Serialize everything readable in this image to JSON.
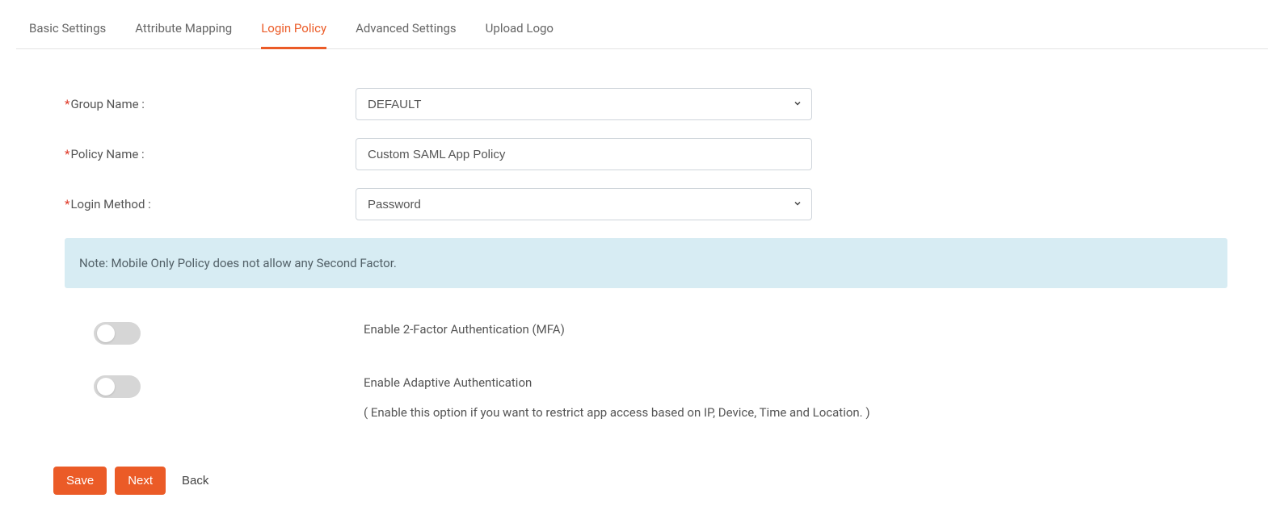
{
  "tabs": [
    {
      "label": "Basic Settings"
    },
    {
      "label": "Attribute Mapping"
    },
    {
      "label": "Login Policy"
    },
    {
      "label": "Advanced Settings"
    },
    {
      "label": "Upload Logo"
    }
  ],
  "form": {
    "group_name_label": "Group Name :",
    "group_name_value": "DEFAULT",
    "policy_name_label": "Policy Name :",
    "policy_name_value": "Custom SAML App Policy",
    "login_method_label": "Login Method :",
    "login_method_value": "Password"
  },
  "note": "Note: Mobile Only Policy does not allow any Second Factor.",
  "toggles": {
    "mfa_label": "Enable 2-Factor Authentication (MFA)",
    "adaptive_label": "Enable Adaptive Authentication",
    "adaptive_sub": "( Enable this option if you want to restrict app access based on IP, Device, Time and Location. )"
  },
  "buttons": {
    "save": "Save",
    "next": "Next",
    "back": "Back"
  }
}
